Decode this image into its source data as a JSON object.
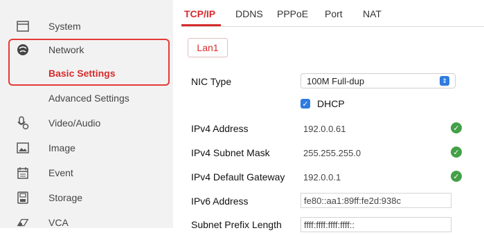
{
  "sidebar": {
    "items": [
      {
        "label": "System",
        "icon": "system-icon"
      },
      {
        "label": "Network",
        "icon": "network-icon"
      },
      {
        "label": "Basic Settings"
      },
      {
        "label": "Advanced Settings"
      },
      {
        "label": "Video/Audio",
        "icon": "video-audio-icon"
      },
      {
        "label": "Image",
        "icon": "image-icon"
      },
      {
        "label": "Event",
        "icon": "event-icon"
      },
      {
        "label": "Storage",
        "icon": "storage-icon"
      },
      {
        "label": "VCA",
        "icon": "vca-icon"
      }
    ],
    "active_label": "Basic Settings"
  },
  "tabs": [
    {
      "label": "TCP/IP",
      "active": true
    },
    {
      "label": "DDNS"
    },
    {
      "label": "PPPoE"
    },
    {
      "label": "Port"
    },
    {
      "label": "NAT"
    }
  ],
  "lan": {
    "label": "Lan1"
  },
  "form": {
    "nic_type": {
      "label": "NIC Type",
      "value": "100M Full-dup"
    },
    "dhcp": {
      "label": "DHCP",
      "checked": true
    },
    "ipv4_address": {
      "label": "IPv4 Address",
      "value": "192.0.0.61"
    },
    "ipv4_mask": {
      "label": "IPv4 Subnet Mask",
      "value": "255.255.255.0"
    },
    "ipv4_gateway": {
      "label": "IPv4 Default Gateway",
      "value": "192.0.0.1"
    },
    "ipv6_address": {
      "label": "IPv6 Address",
      "value": "fe80::aa1:89ff:fe2d:938c"
    },
    "subnet_prefix": {
      "label": "Subnet Prefix Length",
      "value": "ffff:ffff:ffff:ffff::"
    }
  },
  "colors": {
    "accent": "#d62b2b",
    "ok": "#43a047",
    "select_blue": "#2f7be0"
  }
}
